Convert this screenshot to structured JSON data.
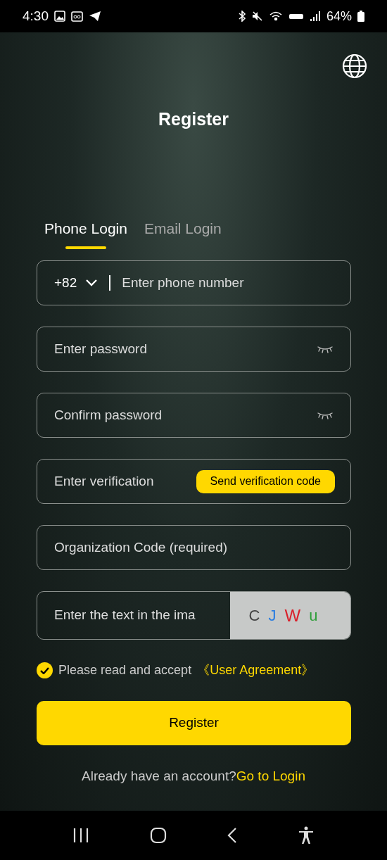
{
  "status_bar": {
    "time": "4:30",
    "battery": "64%"
  },
  "title": "Register",
  "tabs": [
    {
      "label": "Phone Login",
      "selected": true
    },
    {
      "label": "Email Login",
      "selected": false
    }
  ],
  "phone": {
    "country_code": "+82",
    "placeholder": "Enter phone number"
  },
  "fields": [
    {
      "kind": "password",
      "placeholder": "Enter password"
    },
    {
      "kind": "password",
      "placeholder": "Confirm password"
    },
    {
      "kind": "code",
      "placeholder": "Enter verification",
      "action": "Send verification code"
    },
    {
      "kind": "text",
      "placeholder": "Organization Code (required)"
    }
  ],
  "captcha": {
    "placeholder": "Enter the text in the ima",
    "chars": [
      {
        "char": "C",
        "color": "#444444"
      },
      {
        "char": "J",
        "color": "#2a7de1"
      },
      {
        "char": "W",
        "color": "#d9202a"
      },
      {
        "char": "u",
        "color": "#2e9e3a"
      }
    ]
  },
  "agreement": {
    "checked": true,
    "text": "Please read and accept",
    "link": "《User Agreement》"
  },
  "register_button": "Register",
  "footer": {
    "text": "Already have an account?",
    "link": "Go to Login"
  }
}
